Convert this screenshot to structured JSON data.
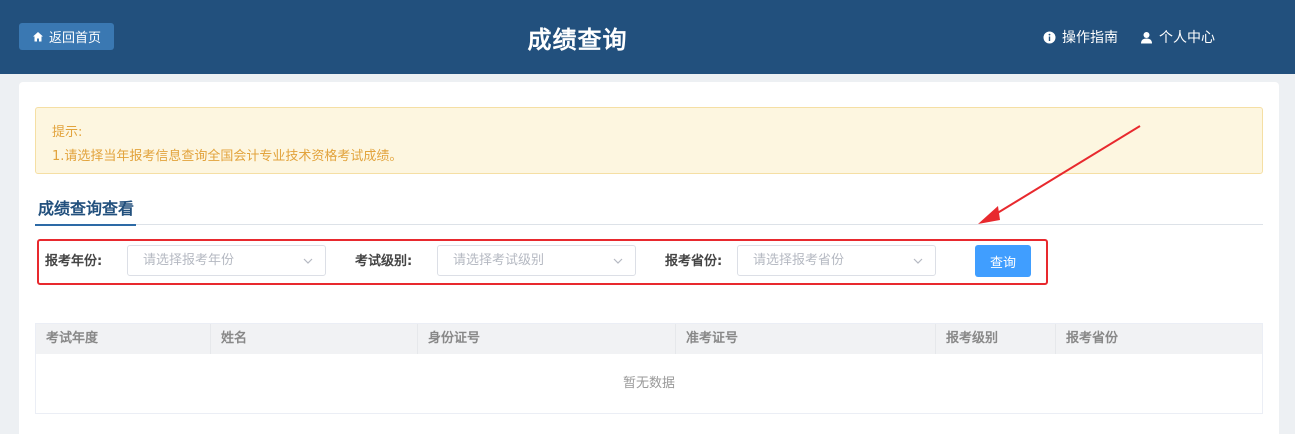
{
  "header": {
    "home_label": "返回首页",
    "title": "成绩查询",
    "guide_label": "操作指南",
    "user_label": "个人中心"
  },
  "tip": {
    "title": "提示:",
    "line1": "1.请选择当年报考信息查询全国会计专业技术资格考试成绩。"
  },
  "section": {
    "title": "成绩查询查看"
  },
  "filters": {
    "year_label": "报考年份:",
    "year_placeholder": "请选择报考年份",
    "level_label": "考试级别:",
    "level_placeholder": "请选择考试级别",
    "province_label": "报考省份:",
    "province_placeholder": "请选择报考省份",
    "query_label": "查询"
  },
  "table": {
    "columns": [
      "考试年度",
      "姓名",
      "身份证号",
      "准考证号",
      "报考级别",
      "报考省份"
    ],
    "empty_text": "暂无数据"
  },
  "colors": {
    "header_bg": "#22507d",
    "accent": "#409eff",
    "highlight": "#e8292e"
  }
}
